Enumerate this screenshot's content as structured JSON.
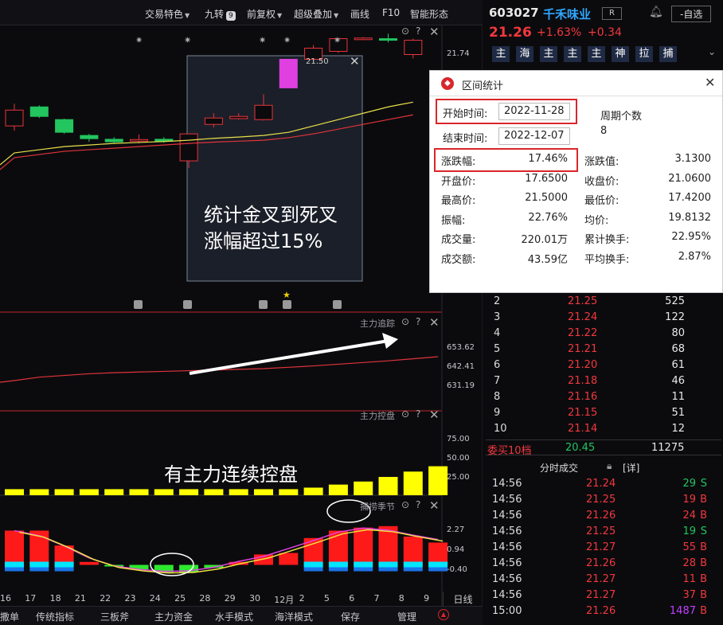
{
  "toolbar": {
    "items": [
      "交易特色",
      "九转",
      "前复权",
      "超级叠加",
      "画线",
      "F10",
      "智能形态"
    ],
    "nine_badge": "9"
  },
  "stock": {
    "code": "603027",
    "name": "千禾味业",
    "r_badge": "R",
    "watch_btn": "-自选",
    "price": "21.26",
    "change_pct": "+1.63%",
    "change_abs": "+0.34",
    "tags": [
      "主",
      "海",
      "主",
      "主",
      "主",
      "神",
      "拉",
      "捕"
    ]
  },
  "popup": {
    "title": "区间统计",
    "start_label": "开始时间:",
    "start_value": "2022-11-28",
    "end_label": "结束时间:",
    "end_value": "2022-12-07",
    "period_label": "周期个数",
    "period_value": "8",
    "rows": [
      {
        "l1": "涨跌幅:",
        "v1": "17.46%",
        "l2": "涨跌值:",
        "v2": "3.1300"
      },
      {
        "l1": "开盘价:",
        "v1": "17.6500",
        "l2": "收盘价:",
        "v2": "21.0600"
      },
      {
        "l1": "最高价:",
        "v1": "21.5000",
        "l2": "最低价:",
        "v2": "17.4200"
      },
      {
        "l1": "振幅:",
        "v1": "22.76%",
        "l2": "均价:",
        "v2": "19.8132"
      },
      {
        "l1": "成交量:",
        "v1": "220.01万",
        "l2": "累计换手:",
        "v2": "22.95%"
      },
      {
        "l1": "成交额:",
        "v1": "43.59亿",
        "l2": "平均换手:",
        "v2": "2.87%"
      }
    ]
  },
  "annotations": {
    "box_text1": "统计金叉到死叉",
    "box_text2": "涨幅超过15%",
    "control_text": "有主力连续控盘",
    "box_high": "21.50"
  },
  "panels": {
    "main_axis": "21.74",
    "zlzz_label": "主力追踪",
    "zlzz_axis": [
      "653.62",
      "642.41",
      "631.19"
    ],
    "zlkp_label": "主力控盘",
    "zlkp_axis": [
      "75.00",
      "50.00",
      "25.00"
    ],
    "blj_label": "捕捞季节",
    "blj_axis": [
      "2.27",
      "0.94",
      "-0.40"
    ]
  },
  "xaxis": {
    "labels": [
      "16",
      "17",
      "18",
      "21",
      "22",
      "23",
      "24",
      "25",
      "28",
      "29",
      "30",
      "12月",
      "2",
      "5",
      "6",
      "7",
      "8",
      "9"
    ],
    "period": "日线"
  },
  "orderbook": {
    "asks": [
      {
        "n": "2",
        "p": "21.25",
        "v": "525"
      },
      {
        "n": "3",
        "p": "21.24",
        "v": "122"
      },
      {
        "n": "4",
        "p": "21.22",
        "v": "80"
      },
      {
        "n": "5",
        "p": "21.21",
        "v": "68"
      },
      {
        "n": "6",
        "p": "21.20",
        "v": "61"
      },
      {
        "n": "7",
        "p": "21.18",
        "v": "46"
      },
      {
        "n": "8",
        "p": "21.16",
        "v": "11"
      },
      {
        "n": "9",
        "p": "21.15",
        "v": "51"
      },
      {
        "n": "10",
        "p": "21.14",
        "v": "12"
      }
    ],
    "buy10_label": "委买10档",
    "buy10_price": "20.45",
    "buy10_vol": "11275"
  },
  "trades": {
    "title": "分时成交",
    "detail": "[详]",
    "rows": [
      {
        "t": "14:56",
        "p": "21.24",
        "v": "29",
        "s": "S"
      },
      {
        "t": "14:56",
        "p": "21.25",
        "v": "19",
        "s": "B"
      },
      {
        "t": "14:56",
        "p": "21.26",
        "v": "24",
        "s": "B"
      },
      {
        "t": "14:56",
        "p": "21.25",
        "v": "19",
        "s": "S"
      },
      {
        "t": "14:56",
        "p": "21.27",
        "v": "55",
        "s": "B"
      },
      {
        "t": "14:56",
        "p": "21.26",
        "v": "28",
        "s": "B"
      },
      {
        "t": "14:56",
        "p": "21.27",
        "v": "11",
        "s": "B"
      },
      {
        "t": "14:56",
        "p": "21.27",
        "v": "37",
        "s": "B"
      },
      {
        "t": "15:00",
        "p": "21.26",
        "v": "1487",
        "s": "B"
      }
    ]
  },
  "bottom_tabs": [
    "撒单",
    "传统指标",
    "三板斧",
    "主力资金",
    "水手模式",
    "海洋模式",
    "保存",
    "管理"
  ],
  "chart_data": {
    "type": "candlestick",
    "categories": [
      "16",
      "17",
      "18",
      "21",
      "22",
      "23",
      "24",
      "25",
      "28",
      "29",
      "30",
      "12月",
      "2",
      "5",
      "6",
      "7",
      "8",
      "9"
    ],
    "candles": [
      {
        "o": 18.75,
        "c": 19.25,
        "h": 19.45,
        "l": 18.6
      },
      {
        "o": 19.35,
        "c": 19.05,
        "h": 19.4,
        "l": 19.0
      },
      {
        "o": 18.95,
        "c": 18.55,
        "h": 18.98,
        "l": 18.5
      },
      {
        "o": 18.45,
        "c": 18.35,
        "h": 18.5,
        "l": 18.25
      },
      {
        "o": 18.33,
        "c": 18.25,
        "h": 18.4,
        "l": 18.2
      },
      {
        "o": 18.28,
        "c": 18.32,
        "h": 18.48,
        "l": 18.2
      },
      {
        "o": 18.33,
        "c": 18.27,
        "h": 18.4,
        "l": 18.22
      },
      {
        "o": 17.65,
        "c": 18.5,
        "h": 18.5,
        "l": 17.42
      },
      {
        "o": 18.8,
        "c": 19.0,
        "h": 19.15,
        "l": 18.7
      },
      {
        "o": 18.98,
        "c": 19.05,
        "h": 19.15,
        "l": 18.95
      },
      {
        "o": 18.95,
        "c": 19.4,
        "h": 19.75,
        "l": 18.92
      },
      {
        "o": 19.95,
        "c": 20.85,
        "h": 20.85,
        "l": 19.95
      },
      {
        "o": 20.85,
        "c": 21.2,
        "h": 21.3,
        "l": 20.8
      },
      {
        "o": 21.1,
        "c": 21.5,
        "h": 21.5,
        "l": 21.05
      },
      {
        "o": 21.47,
        "c": 21.52,
        "h": 21.55,
        "l": 21.45
      },
      {
        "o": 21.5,
        "c": 21.45,
        "h": 21.66,
        "l": 21.38
      },
      {
        "o": 21.0,
        "c": 21.45,
        "h": 21.5,
        "l": 20.88
      }
    ],
    "ma_yellow": [
      17.9,
      18.0,
      18.1,
      18.15,
      18.2,
      18.23,
      18.26,
      18.3,
      18.36,
      18.4,
      18.45,
      18.55,
      18.75,
      18.95,
      19.15,
      19.35,
      19.5
    ],
    "ma_red": [
      17.75,
      17.85,
      17.95,
      18.0,
      18.05,
      18.1,
      18.15,
      18.2,
      18.24,
      18.27,
      18.3,
      18.38,
      18.5,
      18.65,
      18.8,
      18.95,
      19.1
    ],
    "control_bars": [
      10,
      10,
      10,
      10,
      10,
      10,
      10,
      10,
      10,
      10,
      10,
      10,
      12,
      16,
      20,
      26,
      33,
      40
    ],
    "season_bars": [
      2.3,
      2.3,
      1.3,
      0.2,
      -0.1,
      -0.3,
      -0.5,
      -0.5,
      -0.2,
      0.2,
      0.7,
      0.8,
      1.8,
      2.3,
      2.5,
      2.6,
      1.9,
      1.5
    ],
    "zlzz_line": [
      634,
      636,
      637,
      638,
      638.6,
      639,
      639.4,
      639.8,
      640.2,
      640.6,
      641,
      641.8,
      642.6,
      643.6,
      644.6,
      645.6,
      646.8,
      648
    ]
  }
}
